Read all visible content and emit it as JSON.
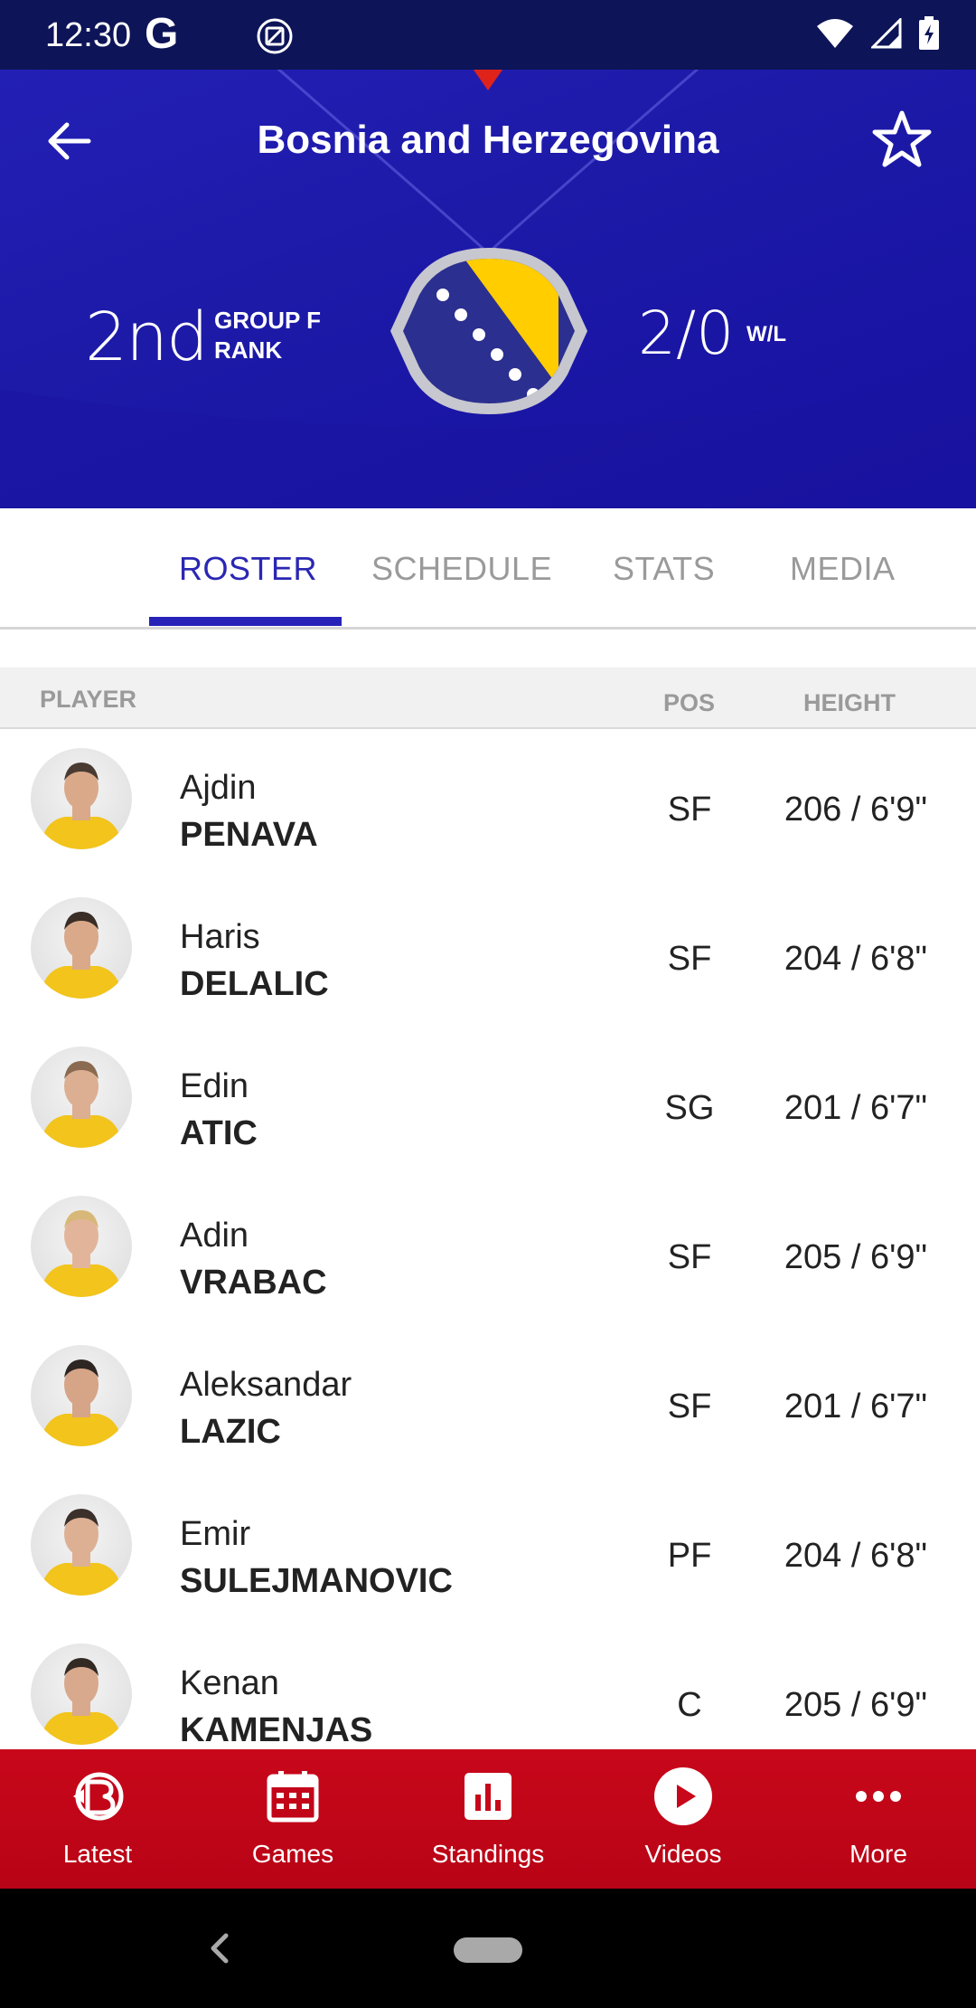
{
  "status_bar": {
    "time": "12:30",
    "g_icon": "G"
  },
  "header": {
    "title": "Bosnia and Herzegovina",
    "rank": "2nd",
    "rank_label_line1": "GROUP F",
    "rank_label_line2": "RANK",
    "record": "2/0",
    "record_label": "W/L",
    "colors": {
      "background": "#1f1cac",
      "accent": "#ffcd00"
    }
  },
  "tabs": [
    {
      "label": "ROSTER",
      "active": true
    },
    {
      "label": "SCHEDULE",
      "active": false
    },
    {
      "label": "STATS",
      "active": false
    },
    {
      "label": "MEDIA",
      "active": false
    }
  ],
  "table_header": {
    "player": "PLAYER",
    "pos": "POS",
    "height": "HEIGHT"
  },
  "players": [
    {
      "first": "Ajdin",
      "last": "PENAVA",
      "pos": "SF",
      "height": "206 / 6'9\""
    },
    {
      "first": "Haris",
      "last": "DELALIC",
      "pos": "SF",
      "height": "204 / 6'8\""
    },
    {
      "first": "Edin",
      "last": "ATIC",
      "pos": "SG",
      "height": "201 / 6'7\""
    },
    {
      "first": "Adin",
      "last": "VRABAC",
      "pos": "SF",
      "height": "205 / 6'9\""
    },
    {
      "first": "Aleksandar",
      "last": "LAZIC",
      "pos": "SF",
      "height": "201 / 6'7\""
    },
    {
      "first": "Emir",
      "last": "SULEJMANOVIC",
      "pos": "PF",
      "height": "204 / 6'8\""
    },
    {
      "first": "Kenan",
      "last": "KAMENJAS",
      "pos": "C",
      "height": "205 / 6'9\""
    }
  ],
  "bottom_nav": [
    {
      "label": "Latest",
      "icon": "basketball-logo-icon"
    },
    {
      "label": "Games",
      "icon": "calendar-icon"
    },
    {
      "label": "Standings",
      "icon": "bar-chart-icon"
    },
    {
      "label": "Videos",
      "icon": "play-icon"
    },
    {
      "label": "More",
      "icon": "more-dots-icon"
    }
  ],
  "colors": {
    "nav_red": "#c8071a",
    "tab_active": "#2a27b3",
    "tab_inactive": "#9a9a9a"
  }
}
